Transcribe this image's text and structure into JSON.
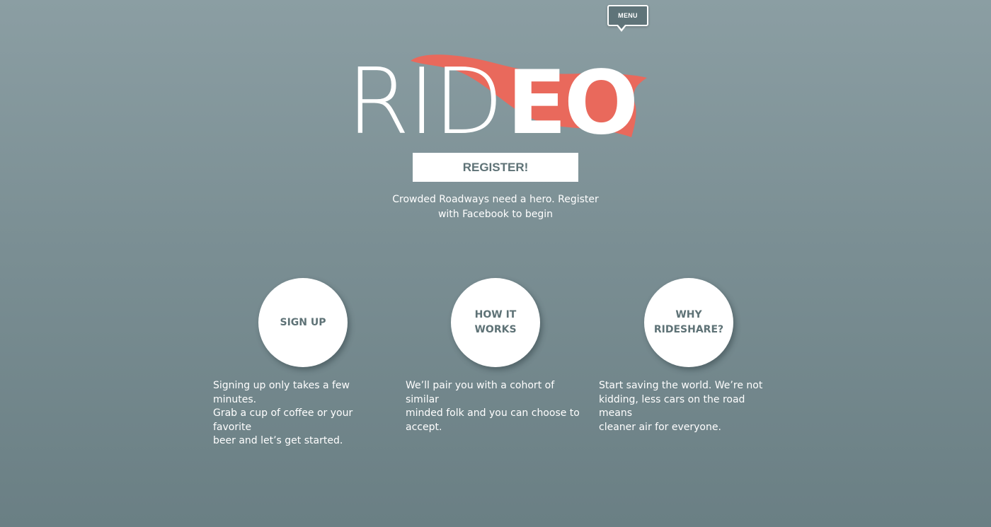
{
  "header": {
    "menu_label": "MENU"
  },
  "logo": {
    "thin_text": "RID",
    "bold_text": "EO",
    "accent_color": "#e9695c"
  },
  "hero": {
    "register_label": "REGISTER!",
    "tagline_line1": "Crowded Roadways need a hero. Register",
    "tagline_line2": "with Facebook to begin"
  },
  "features": [
    {
      "title_line1": "SIGN UP",
      "title_line2": "",
      "desc_line1": "Signing up only takes a few minutes.",
      "desc_line2": "Grab a cup of coffee or your favorite",
      "desc_line3": "beer and let’s get started."
    },
    {
      "title_line1": "HOW IT",
      "title_line2": "WORKS",
      "desc_line1": "We’ll pair you with a cohort of similar",
      "desc_line2": "minded folk and you can choose to",
      "desc_line3": "accept."
    },
    {
      "title_line1": "WHY",
      "title_line2": "RIDESHARE?",
      "desc_line1": "Start saving the world. We’re not",
      "desc_line2": "kidding, less cars on the road means",
      "desc_line3": "cleaner air for everyone."
    }
  ],
  "colors": {
    "background_top": "#8b9ea3",
    "background_bottom": "#6a7f84",
    "text_dark": "#5e7276"
  }
}
